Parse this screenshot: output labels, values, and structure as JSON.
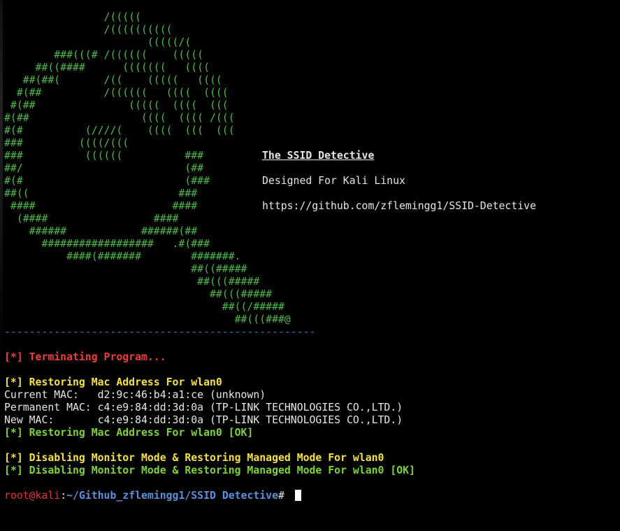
{
  "banner": {
    "ascii_art": "                /(((((\n                /((((((((((\n                       (((((/(\n        ###(((# /((((((    (((((\n     ##((####      (((((((   ((((\n   ##(##(       /((    (((((   ((((\n  #(##          /((((((   ((((  ((((\n #(##               (((((  ((((  (((\n#(##                  ((((  (((( /(((\n#(#          (////(    ((((  (((  (((\n###         ((((/(((\n###          ((((((          ###\n##/                          (##\n#(#                          (###\n##((                        ###\n ####                      ####\n  (####                 ####\n    ######            ######(##\n      ##################   .#(###\n          ####(#######        #######.\n                              ##((#####\n                               ##(((#####\n                                 ##(((#####\n                                   ##((/#####\n                                     ##(((###@",
    "title": "The SSID Detective",
    "subtitle": "Designed For Kali Linux",
    "url": "https://github.com/zflemingg1/SSID-Detective"
  },
  "colors": {
    "background": "#000000",
    "art": "#4fb84a",
    "separator": "#3d79b8",
    "red": "#e84040",
    "yellow": "#f4e04a",
    "green": "#7ed23c",
    "text": "#e6e6e6",
    "prompt_user": "#e23636",
    "prompt_path": "#5f8fd8"
  },
  "output": {
    "separator": "--------------------------------------------------",
    "terminating": "[*] Terminating Program...",
    "restoring_mac": "[*] Restoring Mac Address For wlan0",
    "current_mac": "Current MAC:   d2:9c:46:b4:a1:ce (unknown)",
    "permanent_mac": "Permanent MAC: c4:e9:84:dd:3d:0a (TP-LINK TECHNOLOGIES CO.,LTD.)",
    "new_mac": "New MAC:       c4:e9:84:dd:3d:0a (TP-LINK TECHNOLOGIES CO.,LTD.)",
    "restoring_mac_ok": "[*] Restoring Mac Address For wlan0 [OK]",
    "disabling_monitor": "[*] Disabling Monitor Mode & Restoring Managed Mode For wlan0",
    "disabling_monitor_ok": "[*] Disabling Monitor Mode & Restoring Managed Mode For wlan0 [OK]"
  },
  "prompt": {
    "user_host": "root@kali",
    "colon": ":",
    "path": "~/Github_zflemingg1/SSID Detective",
    "symbol": "# "
  }
}
